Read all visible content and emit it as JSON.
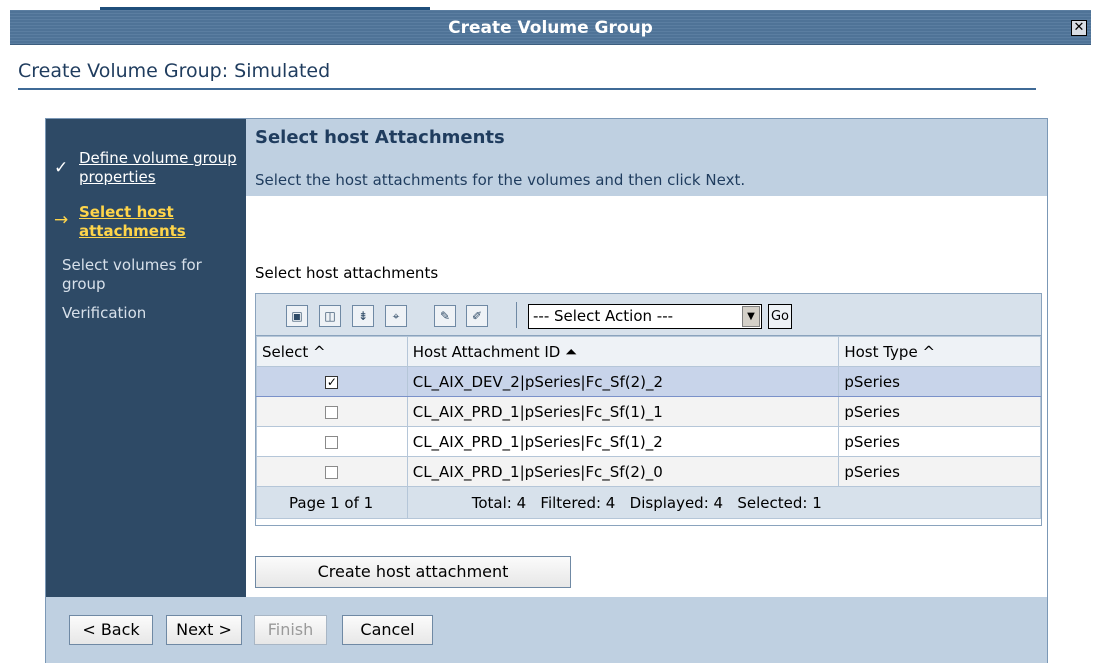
{
  "window": {
    "title": "Create Volume Group",
    "close_glyph": "✕"
  },
  "page": {
    "title": "Create Volume Group: Simulated"
  },
  "wizard": {
    "steps": [
      {
        "label": "Define volume group properties",
        "state": "done",
        "marker": "✓"
      },
      {
        "label": "Select host attachments",
        "state": "current",
        "marker": "→"
      },
      {
        "label": "Select volumes for group",
        "state": "pending"
      },
      {
        "label": "Verification",
        "state": "pending"
      }
    ]
  },
  "section": {
    "title": "Select host Attachments",
    "description": "Select the host attachments for the volumes and then click Next.",
    "table_label": "Select host attachments"
  },
  "toolbar": {
    "icons": [
      "select-all-icon",
      "deselect-all-icon",
      "show-filter-row-icon",
      "clear-filters-icon",
      "edit-sort-icon",
      "clear-sort-icon"
    ],
    "action_select": "--- Select Action ---",
    "go_label": "Go"
  },
  "table": {
    "columns": [
      "Select ^",
      "Host Attachment ID ⏶",
      "Host Type ^"
    ],
    "rows": [
      {
        "selected": true,
        "id": "CL_AIX_DEV_2|pSeries|Fc_Sf(2)_2",
        "type": "pSeries"
      },
      {
        "selected": false,
        "id": "CL_AIX_PRD_1|pSeries|Fc_Sf(1)_1",
        "type": "pSeries"
      },
      {
        "selected": false,
        "id": "CL_AIX_PRD_1|pSeries|Fc_Sf(1)_2",
        "type": "pSeries"
      },
      {
        "selected": false,
        "id": "CL_AIX_PRD_1|pSeries|Fc_Sf(2)_0",
        "type": "pSeries"
      }
    ],
    "footer_page": "Page 1 of 1",
    "footer_counts": "Total: 4   Filtered: 4   Displayed: 4   Selected: 1"
  },
  "create_button": "Create host attachment",
  "buttons": {
    "back": "< Back",
    "next": "Next >",
    "finish": "Finish",
    "cancel": "Cancel"
  },
  "colors": {
    "nav_bg": "#2e4a66",
    "header_bg": "#bfd0e1",
    "accent_current": "#ffd54a",
    "selected_row": "#c8d4ea"
  }
}
